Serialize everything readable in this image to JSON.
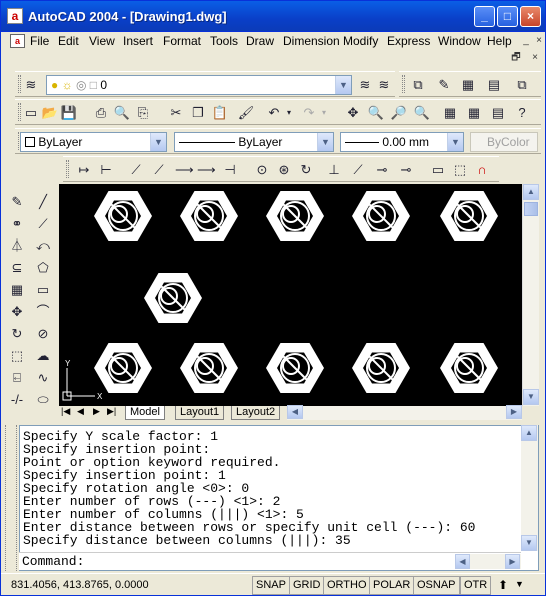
{
  "window": {
    "title": "AutoCAD 2004 - [Drawing1.dwg]",
    "app_icon": "a",
    "controls": [
      "_",
      "□",
      "×"
    ]
  },
  "menu": [
    "File",
    "Edit",
    "View",
    "Insert",
    "Format",
    "Tools",
    "Draw",
    "Dimension",
    "Modify",
    "Express",
    "Window",
    "Help"
  ],
  "layers": {
    "current": "0"
  },
  "properties": {
    "color": "ByLayer",
    "linetype": "ByLayer",
    "lineweight": "0.00 mm",
    "plotstyle": "ByColor"
  },
  "tabs": [
    "Model",
    "Layout1",
    "Layout2"
  ],
  "command_history": [
    "Specify Y scale factor: 1",
    "Specify insertion point:",
    "Point or option keyword required.",
    "Specify insertion point: 1",
    "Specify rotation angle <0>: 0",
    "Enter number of rows (---) <1>: 2",
    "Enter number of columns (|||) <1>: 5",
    "Enter distance between rows or specify unit cell (---): 60",
    "Specify distance between columns (|||): 35"
  ],
  "command_prompt": "Command:",
  "status": {
    "coordinates": "831.4056, 413.8765, 0.0000",
    "buttons": [
      "SNAP",
      "GRID",
      "ORTHO",
      "POLAR",
      "OSNAP",
      "OTR"
    ]
  },
  "canvas": {
    "background": "#000000",
    "drawing_color": "#ffffff",
    "ucs_labels": [
      "X",
      "Y"
    ]
  }
}
